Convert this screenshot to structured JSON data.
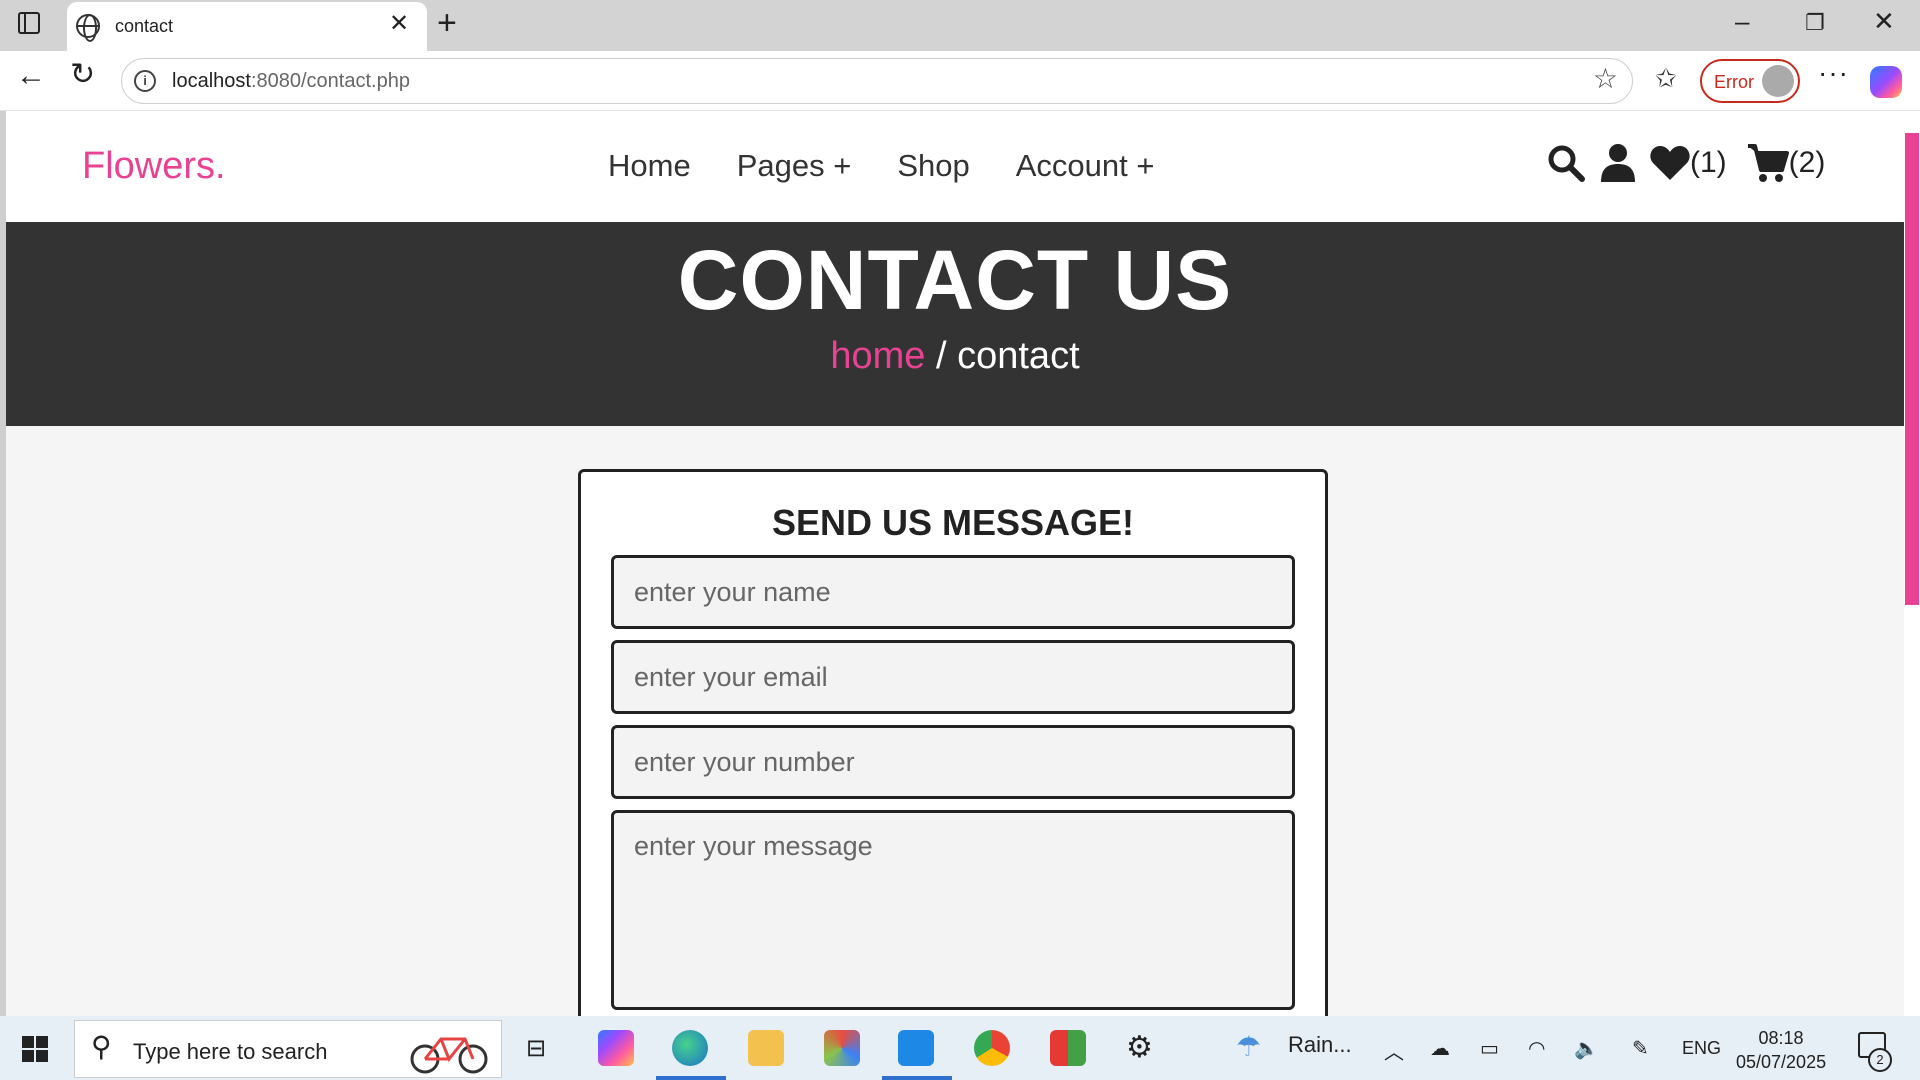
{
  "browser": {
    "tab_title": "contact",
    "url_host": "localhost",
    "url_rest": ":8080/contact.php",
    "profile_status": "Error"
  },
  "site": {
    "logo": "Flowers.",
    "nav": [
      "Home",
      "Pages +",
      "Shop",
      "Account +"
    ],
    "wishlist_count": "(1)",
    "cart_count": "(2)",
    "brand_color": "#e84393"
  },
  "heading": {
    "title": "CONTACT US",
    "crumb_home": "home",
    "crumb_sep": " / ",
    "crumb_current": "contact"
  },
  "form": {
    "title": "SEND US MESSAGE!",
    "name_placeholder": "enter your name",
    "email_placeholder": "enter your email",
    "number_placeholder": "enter your number",
    "message_placeholder": "enter your message"
  },
  "taskbar": {
    "search_placeholder": "Type here to search",
    "weather": "Rain...",
    "language": "ENG",
    "time": "08:18",
    "date": "05/07/2025",
    "notification_count": "2"
  }
}
